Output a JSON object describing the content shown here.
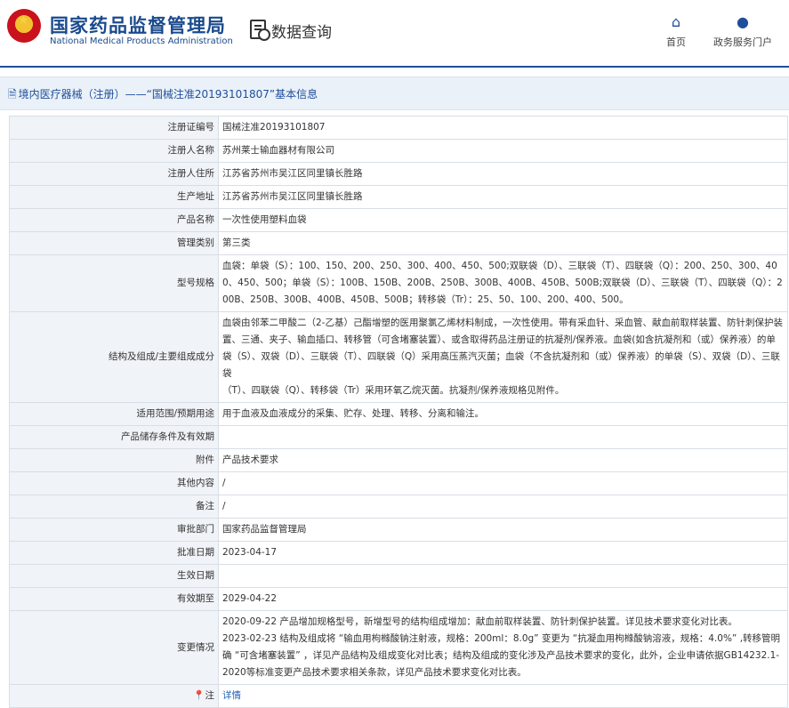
{
  "header": {
    "org_name_cn": "国家药品监督管理局",
    "org_name_en": "National Medical Products Administration",
    "page_title": "数据查询",
    "nav": {
      "home": "首页",
      "gov_portal": "政务服务门户"
    }
  },
  "breadcrumb": {
    "text": "境内医疗器械（注册）——“国械注准20193101807”基本信息"
  },
  "fields": {
    "reg_no": {
      "label": "注册证编号",
      "value": "国械注准20193101807"
    },
    "registrant_name": {
      "label": "注册人名称",
      "value": "苏州莱士输血器材有限公司"
    },
    "registrant_address": {
      "label": "注册人住所",
      "value": "江苏省苏州市吴江区同里镇长胜路"
    },
    "production_address": {
      "label": "生产地址",
      "value": "江苏省苏州市吴江区同里镇长胜路"
    },
    "product_name": {
      "label": "产品名称",
      "value": "一次性使用塑料血袋"
    },
    "category": {
      "label": "管理类别",
      "value": "第三类"
    },
    "model_spec": {
      "label": "型号规格",
      "value": "血袋：单袋（S）：100、150、200、250、300、400、450、500;双联袋（D）、三联袋（T）、四联袋（Q）：200、250、300、400、450、500；单袋（S）：100B、150B、200B、250B、300B、400B、450B、500B;双联袋（D）、三联袋（T）、四联袋（Q）：200B、250B、300B、400B、450B、500B；转移袋（Tr）：25、50、100、200、400、500。"
    },
    "structure": {
      "label": "结构及组成/主要组成成分",
      "line1": "血袋由邻苯二甲酸二（2-乙基）己酯增塑的医用聚氯乙烯材料制成，一次性使用。带有采血针、采血管、献血前取样装置、防针刺保护装置、三通、夹子、输血插口、转移管（可含堵塞装置）、或含取得药品注册证的抗凝剂/保养液。血袋(如含抗凝剂和（或）保养液）的单袋（S）、双袋（D）、三联袋（T）、四联袋（Q）采用高压蒸汽灭菌；血袋（不含抗凝剂和（或）保养液）的单袋（S）、双袋（D）、三联袋",
      "line2": "（T）、四联袋（Q）、转移袋（Tr）采用环氧乙烷灭菌。抗凝剂/保养液规格见附件。"
    },
    "scope": {
      "label": "适用范围/预期用途",
      "value": "用于血液及血液成分的采集、贮存、处理、转移、分离和输注。"
    },
    "storage": {
      "label": "产品储存条件及有效期",
      "value": ""
    },
    "attachment": {
      "label": "附件",
      "value": "产品技术要求"
    },
    "other": {
      "label": "其他内容",
      "value": "/"
    },
    "remark": {
      "label": "备注",
      "value": "/"
    },
    "approval_dept": {
      "label": "审批部门",
      "value": "国家药品监督管理局"
    },
    "approval_date": {
      "label": "批准日期",
      "value": "2023-04-17"
    },
    "effective_date": {
      "label": "生效日期",
      "value": ""
    },
    "expiry_date": {
      "label": "有效期至",
      "value": "2029-04-22"
    },
    "changes": {
      "label": "变更情况",
      "line1": "2020-09-22 产品增加规格型号，新增型号的结构组成增加：献血前取样装置、防针刺保护装置。详见技术要求变化对比表。",
      "line2": "2023-02-23 结构及组成将 “输血用枸橼酸钠注射液，规格：200ml：8.0g” 变更为 “抗凝血用枸橼酸钠溶液，规格：4.0%” ,转移管明确 “可含堵塞装置” ，详见产品结构及组成变化对比表；结构及组成的变化涉及产品技术要求的变化，此外，企业申请依据GB14232.1-2020等标准变更产品技术要求相关条款，详见产品技术要求变化对比表。"
    },
    "note": {
      "label": "注",
      "link": "详情",
      "icon": "location-pin-icon"
    }
  }
}
